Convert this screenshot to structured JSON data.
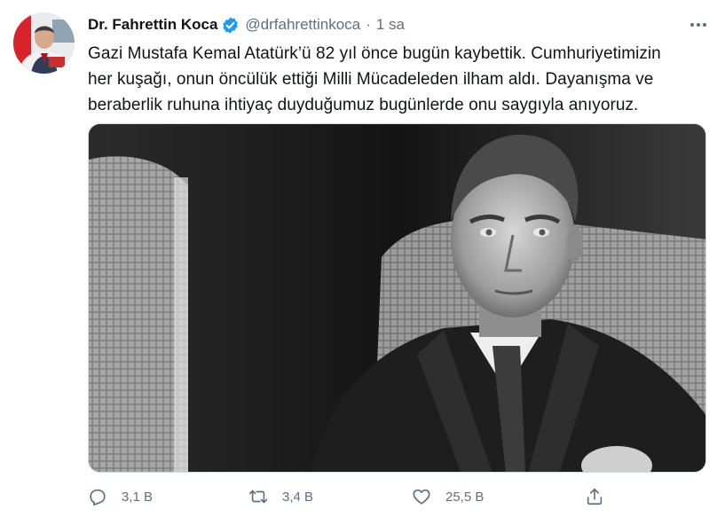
{
  "tweet": {
    "author_name": "Dr. Fahrettin Koca",
    "handle": "@drfahrettinkoca",
    "separator": "·",
    "time": "1 sa",
    "text": "Gazi Mustafa Kemal Atatürk’ü 82 yıl önce bugün kaybettik. Cumhuriyetimizin\nher kuşağı, onun öncülük ettiği Milli Mücadeleden ilham aldı. Dayanışma ve\nberaberlik ruhuna ihtiyaç duyduğumuz bugünlerde onu saygıyla anıyoruz."
  },
  "actions": {
    "reply_count": "3,1 B",
    "retweet_count": "3,4 B",
    "like_count": "25,5 B"
  },
  "icons": {
    "verified": "verified-badge-icon",
    "more": "more-options-icon",
    "reply": "reply-icon",
    "retweet": "retweet-icon",
    "like": "like-icon",
    "share": "share-icon"
  },
  "colors": {
    "verified": "#1d9bf0",
    "text": "#0f1419",
    "secondary": "#5b7083"
  }
}
